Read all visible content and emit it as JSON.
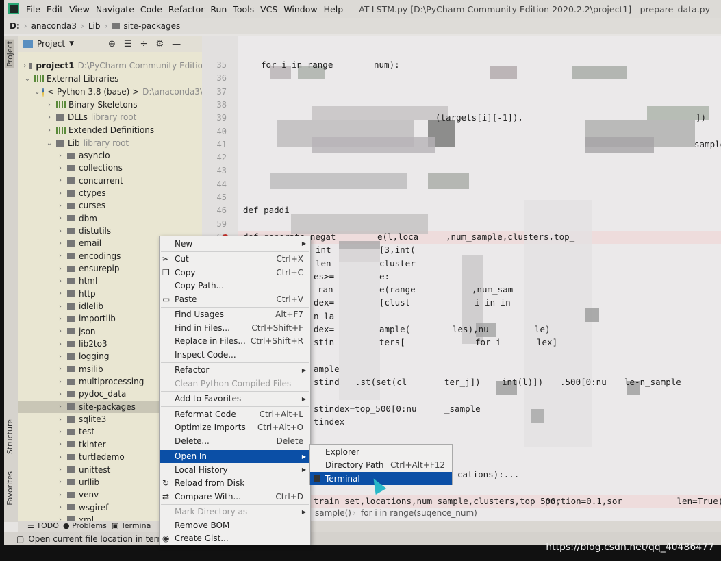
{
  "menubar": {
    "items": [
      "File",
      "Edit",
      "View",
      "Navigate",
      "Code",
      "Refactor",
      "Run",
      "Tools",
      "VCS",
      "Window",
      "Help"
    ],
    "title": "AT-LSTM.py [D:\\PyCharm Community Edition 2020.2.2\\project1] - prepare_data.py"
  },
  "breadcrumb": [
    "D:",
    "anaconda3",
    "Lib",
    "site-packages"
  ],
  "side_tabs": {
    "project": "Project",
    "structure": "Structure",
    "favorites": "Favorites"
  },
  "project_panel": {
    "title": "Project",
    "tree": [
      {
        "label": "project1",
        "hint": "D:\\PyCharm Community Editio",
        "level": 0,
        "expanded": false,
        "icon": "folder",
        "bold": true
      },
      {
        "label": "External Libraries",
        "level": 0,
        "expanded": true,
        "icon": "library"
      },
      {
        "label": "< Python 3.8 (base) >",
        "hint": "D:\\anaconda3\\",
        "level": 1,
        "expanded": true,
        "icon": "python"
      },
      {
        "label": "Binary Skeletons",
        "level": 2,
        "expanded": false,
        "icon": "library"
      },
      {
        "label": "DLLs",
        "hint": "library root",
        "level": 2,
        "expanded": false,
        "icon": "folder"
      },
      {
        "label": "Extended Definitions",
        "level": 2,
        "expanded": false,
        "icon": "library"
      },
      {
        "label": "Lib",
        "hint": "library root",
        "level": 2,
        "expanded": true,
        "icon": "folder"
      },
      {
        "label": "asyncio",
        "level": 3
      },
      {
        "label": "collections",
        "level": 3
      },
      {
        "label": "concurrent",
        "level": 3
      },
      {
        "label": "ctypes",
        "level": 3
      },
      {
        "label": "curses",
        "level": 3
      },
      {
        "label": "dbm",
        "level": 3
      },
      {
        "label": "distutils",
        "level": 3
      },
      {
        "label": "email",
        "level": 3
      },
      {
        "label": "encodings",
        "level": 3
      },
      {
        "label": "ensurepip",
        "level": 3
      },
      {
        "label": "html",
        "level": 3
      },
      {
        "label": "http",
        "level": 3
      },
      {
        "label": "idlelib",
        "level": 3
      },
      {
        "label": "importlib",
        "level": 3
      },
      {
        "label": "json",
        "level": 3
      },
      {
        "label": "lib2to3",
        "level": 3
      },
      {
        "label": "logging",
        "level": 3
      },
      {
        "label": "msilib",
        "level": 3
      },
      {
        "label": "multiprocessing",
        "level": 3
      },
      {
        "label": "pydoc_data",
        "level": 3
      },
      {
        "label": "site-packages",
        "level": 3,
        "selected": true
      },
      {
        "label": "sqlite3",
        "level": 3
      },
      {
        "label": "test",
        "level": 3
      },
      {
        "label": "tkinter",
        "level": 3
      },
      {
        "label": "turtledemo",
        "level": 3
      },
      {
        "label": "unittest",
        "level": 3
      },
      {
        "label": "urllib",
        "level": 3
      },
      {
        "label": "venv",
        "level": 3
      },
      {
        "label": "wsgiref",
        "level": 3
      },
      {
        "label": "xml",
        "level": 3
      }
    ]
  },
  "editor": {
    "lines": [
      {
        "num": "35",
        "segs": [
          "for i in range",
          "num):"
        ]
      },
      {
        "num": "36",
        "segs": []
      },
      {
        "num": "37",
        "segs": []
      },
      {
        "num": "38",
        "segs": []
      },
      {
        "num": "39",
        "segs": [
          "(targets[i][-1]),",
          "])"
        ]
      },
      {
        "num": "40",
        "segs": []
      },
      {
        "num": "41",
        "segs": [
          "sample["
        ]
      },
      {
        "num": "42",
        "segs": []
      },
      {
        "num": "43",
        "segs": []
      },
      {
        "num": "44",
        "segs": []
      },
      {
        "num": "45",
        "segs": []
      },
      {
        "num": "46",
        "segs": [
          "def paddi"
        ]
      },
      {
        "num": "59",
        "segs": []
      },
      {
        "num": "60",
        "segs": [
          "def generate_negat",
          "e(l,loca",
          ",num_sample,clusters,top_"
        ]
      },
      {
        "num": "",
        "segs": [
          "int",
          "[3,int("
        ]
      },
      {
        "num": "",
        "segs": [
          "len",
          "cluster"
        ]
      },
      {
        "num": "",
        "segs": [
          "es>=",
          "e:"
        ]
      },
      {
        "num": "",
        "segs": [
          "ran",
          "e(range",
          ",num_sam"
        ]
      },
      {
        "num": "",
        "segs": [
          "dex=",
          "[clust",
          "i in in"
        ]
      },
      {
        "num": "",
        "segs": [
          "n la"
        ]
      },
      {
        "num": "",
        "segs": [
          "dex=",
          "ample(",
          "les),nu",
          "le)"
        ]
      },
      {
        "num": "",
        "segs": [
          "stin",
          "ters[",
          "for i",
          "lex]"
        ]
      },
      {
        "num": "",
        "segs": []
      },
      {
        "num": "",
        "segs": [
          "ample"
        ]
      },
      {
        "num": "",
        "segs": [
          "stind",
          ".st(set(cl",
          "ter_j])",
          "int(l)])",
          ".500[0:nu",
          "le-n_sample"
        ]
      },
      {
        "num": "",
        "segs": []
      },
      {
        "num": "",
        "segs": [
          "stindex=top_500[0:nu",
          "_sample"
        ]
      },
      {
        "num": "",
        "segs": [
          "tindex"
        ]
      },
      {
        "num": "",
        "segs": []
      },
      {
        "num": "",
        "segs": []
      },
      {
        "num": "",
        "segs": []
      },
      {
        "num": "",
        "segs": [
          "cations):..."
        ]
      },
      {
        "num": "",
        "segs": []
      },
      {
        "num": "",
        "segs": [
          "train_set,locations,num_sample,clusters,top_500,",
          "portion=0.1,sor",
          "_len=True)"
        ]
      }
    ],
    "breadcrumb": [
      "sample()",
      "for i in range(suqence_num)"
    ]
  },
  "context_menu": {
    "items": [
      {
        "label": "New",
        "submenu": true
      },
      {
        "label": "Cut",
        "shortcut": "Ctrl+X",
        "icon": "scissors"
      },
      {
        "label": "Copy",
        "shortcut": "Ctrl+C",
        "icon": "copy"
      },
      {
        "label": "Copy Path..."
      },
      {
        "label": "Paste",
        "shortcut": "Ctrl+V",
        "icon": "clipboard"
      },
      {
        "label": "Find Usages",
        "shortcut": "Alt+F7"
      },
      {
        "label": "Find in Files...",
        "shortcut": "Ctrl+Shift+F"
      },
      {
        "label": "Replace in Files...",
        "shortcut": "Ctrl+Shift+R"
      },
      {
        "label": "Inspect Code..."
      },
      {
        "label": "Refactor",
        "submenu": true
      },
      {
        "label": "Clean Python Compiled Files",
        "disabled": true
      },
      {
        "label": "Add to Favorites",
        "submenu": true
      },
      {
        "label": "Reformat Code",
        "shortcut": "Ctrl+Alt+L"
      },
      {
        "label": "Optimize Imports",
        "shortcut": "Ctrl+Alt+O"
      },
      {
        "label": "Delete...",
        "shortcut": "Delete"
      },
      {
        "label": "Open In",
        "submenu": true,
        "active": true
      },
      {
        "label": "Local History",
        "submenu": true
      },
      {
        "label": "Reload from Disk",
        "icon": "reload"
      },
      {
        "label": "Compare With...",
        "shortcut": "Ctrl+D",
        "icon": "compare"
      },
      {
        "label": "Mark Directory as",
        "submenu": true,
        "disabled": true
      },
      {
        "label": "Remove BOM"
      },
      {
        "label": "Create Gist...",
        "icon": "github"
      }
    ]
  },
  "submenu": {
    "items": [
      {
        "label": "Explorer"
      },
      {
        "label": "Directory Path",
        "shortcut": "Ctrl+Alt+F12"
      },
      {
        "label": "Terminal",
        "active": true,
        "icon": "terminal"
      }
    ]
  },
  "tool_tabs": {
    "todo": "TODO",
    "problems": "Problems",
    "terminal": "Termina"
  },
  "status": "Open current file location in termina",
  "watermark": "https://blog.csdn.net/qq_40486477",
  "colors": {
    "selection": "#0b4fa6",
    "project_bg": "#e9e6d2",
    "cursor": "#2ab8c8"
  }
}
